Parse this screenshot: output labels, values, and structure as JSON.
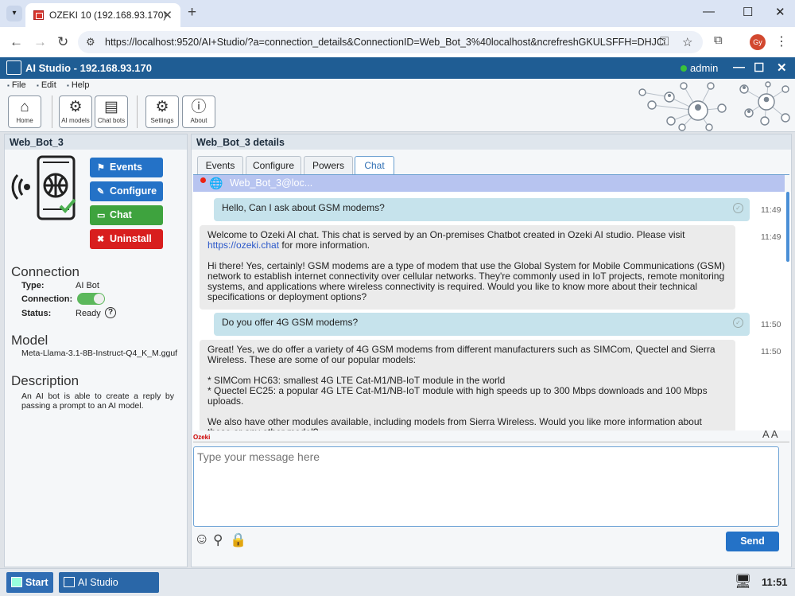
{
  "browser": {
    "tab_title": "OZEKI 10 (192.168.93.170)",
    "url": "https://localhost:9520/AI+Studio/?a=connection_details&ConnectionID=Web_Bot_3%40localhost&ncrefreshGKULSFFH=DHJC",
    "avatar_initials": "Gy"
  },
  "app": {
    "title": "AI Studio - 192.168.93.170",
    "user": "admin",
    "menu": [
      "File",
      "Edit",
      "Help"
    ],
    "toolbar": [
      {
        "label": "Home",
        "icon": "home-icon"
      },
      {
        "label": "AI models",
        "icon": "gears-icon"
      },
      {
        "label": "Chat bots",
        "icon": "chat-bots-icon"
      },
      {
        "label": "Settings",
        "icon": "gear-icon"
      },
      {
        "label": "About",
        "icon": "info-icon"
      }
    ]
  },
  "left": {
    "header": "Web_Bot_3",
    "buttons": {
      "events": "Events",
      "configure": "Configure",
      "chat": "Chat",
      "uninstall": "Uninstall"
    },
    "connection": {
      "title": "Connection",
      "type_label": "Type:",
      "type_value": "AI Bot",
      "connection_label": "Connection:",
      "status_label": "Status:",
      "status_value": "Ready"
    },
    "model": {
      "title": "Model",
      "value": "Meta-Llama-3.1-8B-Instruct-Q4_K_M.gguf"
    },
    "description": {
      "title": "Description",
      "value": "An AI bot is able to create a reply by passing a prompt to an AI model."
    }
  },
  "right": {
    "header": "Web_Bot_3 details",
    "tabs": [
      "Events",
      "Configure",
      "Powers",
      "Chat"
    ],
    "chat_with": "Web_Bot_3@loc...",
    "messages": [
      {
        "from": "user",
        "text": "Hello, Can I ask about GSM modems?",
        "time": "11:49"
      },
      {
        "from": "bot",
        "text_before_link": "Welcome to Ozeki AI chat. This chat is served by an On-premises Chatbot created in Ozeki AI studio. Please visit ",
        "link": "https://ozeki.chat",
        "text_after_link": " for more information.\n\nHi there! Yes, certainly! GSM modems are a type of modem that use the Global System for Mobile Communications (GSM) network to establish internet connectivity over cellular networks. They're commonly used in IoT projects, remote monitoring systems, and applications where wireless connectivity is required. Would you like to know more about their technical specifications or deployment options?",
        "time": "11:49"
      },
      {
        "from": "user",
        "text": "Do you offer 4G GSM modems?",
        "time": "11:50"
      },
      {
        "from": "bot",
        "text": "Great! Yes, we do offer a variety of 4G GSM modems from different manufacturers such as SIMCom, Quectel and Sierra Wireless. These are some of our popular models:\n\n* SIMCom HC63: smallest 4G LTE Cat-M1/NB-IoT module in the world\n* Quectel EC25: a popular 4G LTE Cat-M1/NB-IoT module with high speeds up to 300 Mbps downloads and 100 Mbps uploads.\n\nWe also have other modules available, including models from Sierra Wireless. Would you like more information about these or any other model?",
        "time": "11:50"
      }
    ],
    "brand": "Ozeki",
    "font_controls": "A A",
    "input_placeholder": "Type your message here",
    "send_label": "Send"
  },
  "taskbar": {
    "start_label": "Start",
    "app_label": "AI Studio",
    "clock": "11:51"
  },
  "colors": {
    "title_bar": "#1f5d94",
    "events_button": "#2472c7",
    "chat_button": "#3ea33e",
    "uninstall_button": "#d81e1e",
    "send_button": "#2472c7",
    "chat_header": "#b7c4f0"
  }
}
